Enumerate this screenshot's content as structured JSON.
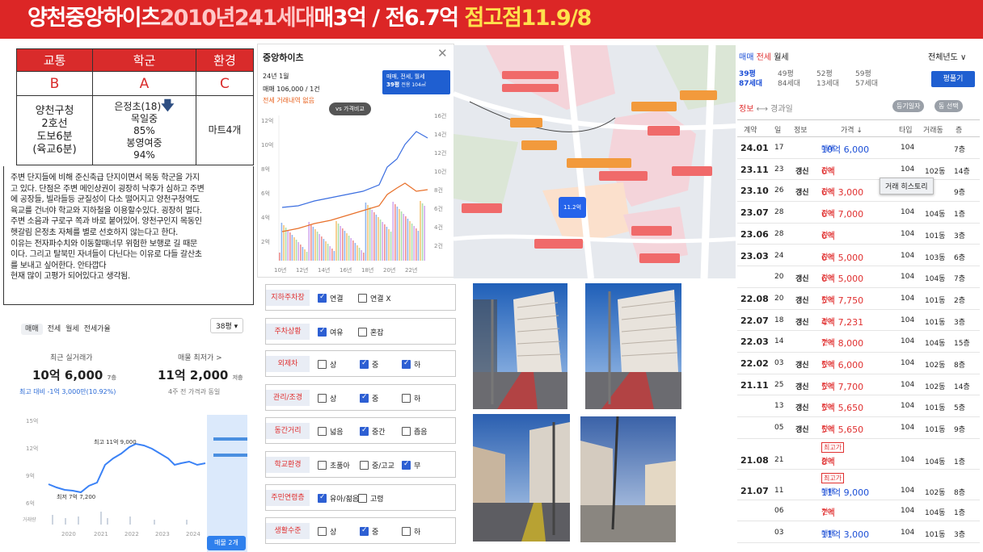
{
  "banner": {
    "part1": "양천중앙하이츠",
    "part2": "2010년241세대",
    "part3": "매3억 / 전6.7억",
    "part4": "점고점11.9/8"
  },
  "rating": {
    "headers": [
      "교통",
      "학군",
      "환경"
    ],
    "grades": [
      "B",
      "A",
      "C"
    ],
    "transport": [
      "양천구청",
      "2호선",
      "도보6분",
      "(육교6분)"
    ],
    "school": [
      "은정초(18)",
      "목일중",
      "85%",
      "봉영여중",
      "94%"
    ],
    "env": "마트4개",
    "arrow_icon": "down-arrow-icon"
  },
  "note": [
    "주변 단지들에 비해 준신축급 단지이면서 목동 학군을 가지",
    "고 있다. 단점은 주변 메인상권이 굉장히 낙후가 심하고 주변",
    "에 공장들, 빌라들등 균질성이 다소 떨어지고 양천구청역도",
    "육교를 건너야 학교와 지하철을 이용할수있다. 굉장히 멀다.",
    "주변 소음과 구로구 쪽과 바로 붙어있어. 양천구인지 목동인",
    "헷갈림 은정초 자체를 별로 선호하지 않는다고 한다.",
    "이유는 전자파수치와 이동할때너무 위험한 보행로 길 때문",
    "이다. 그리고 탈북민 자녀들이 다닌다는 이유로 다들 갈산초",
    "를 보내고 싶어한다. 안타깝다",
    "현재 많이 고평가 되어있다고 생각됨."
  ],
  "left_widget": {
    "tabs": [
      "매매",
      "전세",
      "월세",
      "전세가율"
    ],
    "size": "38평 ▾",
    "recent_label": "최근 실거래가",
    "recent_price": "10억 6,000",
    "recent_floor": "7층",
    "min_label": "매물 최저가 >",
    "min_price": "11억 2,000",
    "min_floor": "저층",
    "recent_diff": "최고 대비 -1억 3,000만(10.92%)",
    "min_sub": "4주 전 가격과 동일",
    "y_ticks": [
      "15억",
      "12억",
      "9억",
      "6억",
      "거래량"
    ],
    "x_ticks": [
      "2020",
      "2021",
      "2022",
      "2023",
      "2024"
    ],
    "max_label": "최고 11억 9,000",
    "min_pt_label": "최저 7억 7,200",
    "sale_btn": "매물 2개"
  },
  "modal": {
    "title": "중앙하이츠",
    "close_icon": "close-icon",
    "period": "24년 1월",
    "sale_line": "매매 106,000 / 1건",
    "jeonse_line": "전세 거래내역 없음",
    "selector1": "매매, 전세, 월세",
    "selector2": "39평",
    "selector3": "전용 104㎡",
    "compare_btn": "vs 가격비교",
    "y_left": [
      "12억",
      "10억",
      "8억",
      "6억",
      "4억",
      "2억"
    ],
    "y_right": [
      "16건",
      "14건",
      "12건",
      "10건",
      "8건",
      "6건",
      "4건",
      "2건"
    ],
    "x_ticks": [
      "10년",
      "12년",
      "14년",
      "16년",
      "18년",
      "20년",
      "22년"
    ]
  },
  "checklist": [
    {
      "label": "지하주차장",
      "opts": [
        [
          "연결",
          true
        ],
        [
          "연결 X",
          false
        ]
      ]
    },
    {
      "label": "주차상황",
      "opts": [
        [
          "여유",
          true
        ],
        [
          "혼잡",
          false
        ]
      ]
    },
    {
      "label": "외제차",
      "opts": [
        [
          "상",
          false
        ],
        [
          "중",
          true
        ],
        [
          "하",
          true
        ]
      ]
    },
    {
      "label": "관리/조경",
      "opts": [
        [
          "상",
          false
        ],
        [
          "중",
          true
        ],
        [
          "하",
          false
        ]
      ]
    },
    {
      "label": "동간거리",
      "opts": [
        [
          "넓음",
          false
        ],
        [
          "중간",
          true
        ],
        [
          "좁음",
          false
        ]
      ]
    },
    {
      "label": "학교환경",
      "opts": [
        [
          "초품아",
          false
        ],
        [
          "중/고교",
          false
        ],
        [
          "무",
          true
        ]
      ]
    },
    {
      "label": "주민연령층",
      "opts": [
        [
          "유아/젊음",
          true
        ],
        [
          "고령",
          false
        ]
      ]
    },
    {
      "label": "생활수준",
      "opts": [
        [
          "상",
          false
        ],
        [
          "중",
          true
        ],
        [
          "하",
          false
        ]
      ]
    }
  ],
  "map": {
    "label": "11.2억"
  },
  "right": {
    "tabs": [
      "매매",
      "전세",
      "월세"
    ],
    "year_sel": "전체년도 ∨",
    "sizes": [
      [
        "39평",
        "87세대"
      ],
      [
        "49평",
        "84세대"
      ],
      [
        "52평",
        "13세대"
      ],
      [
        "59평",
        "57세대"
      ]
    ],
    "compare_btn": "평풀기",
    "info_tab": "정보",
    "path_tab": "경과일",
    "btn1": "등기일자",
    "btn2": "동 선택",
    "headers": [
      "계약",
      "일",
      "정보",
      "가격 ↓",
      "타입",
      "거래동",
      "층"
    ],
    "tooltip": "거래 히스토리",
    "rows": [
      {
        "ym": "24.01",
        "d": "17",
        "info": "",
        "type": "매매",
        "price": "10억 6,000",
        "t": "104",
        "dong": "",
        "fl": "7층"
      },
      {
        "ym": "23.11",
        "d": "23",
        "info": "갱신",
        "type": "전세",
        "price": "6억",
        "t": "104",
        "dong": "102동",
        "fl": "14층"
      },
      {
        "ym": "23.10",
        "d": "26",
        "info": "갱신",
        "type": "전세",
        "price": "6억 3,000",
        "t": "104",
        "dong": "",
        "fl": "9층"
      },
      {
        "ym": "23.07",
        "d": "28",
        "info": "",
        "type": "전세",
        "price": "6억 7,000",
        "t": "104",
        "dong": "104동",
        "fl": "1층"
      },
      {
        "ym": "23.06",
        "d": "28",
        "info": "",
        "type": "전세",
        "price": "6억",
        "t": "104",
        "dong": "101동",
        "fl": "3층"
      },
      {
        "ym": "23.03",
        "d": "24",
        "info": "",
        "type": "전세",
        "price": "6억 5,000",
        "t": "104",
        "dong": "103동",
        "fl": "6층"
      },
      {
        "ym": "",
        "d": "20",
        "info": "갱신",
        "type": "전세",
        "price": "6억 5,000",
        "t": "104",
        "dong": "104동",
        "fl": "7층"
      },
      {
        "ym": "22.08",
        "d": "20",
        "info": "갱신",
        "type": "전세",
        "price": "5억 7,750",
        "t": "104",
        "dong": "101동",
        "fl": "2층"
      },
      {
        "ym": "22.07",
        "d": "18",
        "info": "갱신",
        "type": "전세",
        "price": "4억 7,231",
        "t": "104",
        "dong": "101동",
        "fl": "3층"
      },
      {
        "ym": "22.03",
        "d": "14",
        "info": "",
        "type": "전세",
        "price": "7억 8,000",
        "t": "104",
        "dong": "104동",
        "fl": "15층"
      },
      {
        "ym": "22.02",
        "d": "03",
        "info": "갱신",
        "type": "전세",
        "price": "5억 6,000",
        "t": "104",
        "dong": "102동",
        "fl": "8층"
      },
      {
        "ym": "21.11",
        "d": "25",
        "info": "갱신",
        "type": "전세",
        "price": "5억 7,700",
        "t": "104",
        "dong": "102동",
        "fl": "14층"
      },
      {
        "ym": "",
        "d": "13",
        "info": "갱신",
        "type": "전세",
        "price": "5억 5,650",
        "t": "104",
        "dong": "101동",
        "fl": "5층"
      },
      {
        "ym": "",
        "d": "05",
        "info": "갱신",
        "type": "전세",
        "price": "5억 5,650",
        "t": "104",
        "dong": "101동",
        "fl": "9층"
      },
      {
        "ym": "21.08",
        "d": "21",
        "info": "",
        "badge": "최고가",
        "type": "전세",
        "price": "8억",
        "t": "104",
        "dong": "104동",
        "fl": "1층"
      },
      {
        "ym": "21.07",
        "d": "11",
        "info": "",
        "badge": "최고가",
        "type": "매매",
        "price": "11억 9,000",
        "t": "104",
        "dong": "102동",
        "fl": "8층"
      },
      {
        "ym": "",
        "d": "06",
        "info": "",
        "type": "전세",
        "price": "7억",
        "t": "104",
        "dong": "104동",
        "fl": "1층"
      },
      {
        "ym": "",
        "d": "03",
        "info": "",
        "type": "매매",
        "price": "11억 3,000",
        "t": "104",
        "dong": "101동",
        "fl": "3층"
      }
    ]
  }
}
